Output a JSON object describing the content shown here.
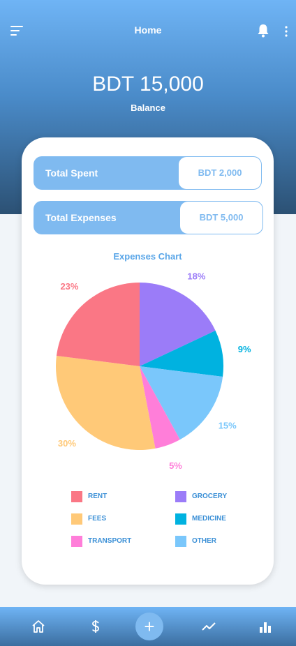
{
  "header": {
    "title": "Home",
    "balance_amount": "BDT 15,000",
    "balance_label": "Balance"
  },
  "icons": {
    "menu": "menu-icon",
    "notifications": "bell-icon",
    "more": "more-vertical-icon"
  },
  "stats": [
    {
      "label": "Total Spent",
      "value": "BDT 2,000"
    },
    {
      "label": "Total Expenses",
      "value": "BDT 5,000"
    }
  ],
  "chart": {
    "title": "Expenses Chart"
  },
  "chart_data": {
    "type": "pie",
    "title": "Expenses Chart",
    "slices": [
      {
        "name": "GROCERY",
        "value": 18,
        "label": "18%",
        "color": "#9b7cf8"
      },
      {
        "name": "MEDICINE",
        "value": 9,
        "label": "9%",
        "color": "#00b2e0"
      },
      {
        "name": "OTHER",
        "value": 15,
        "label": "15%",
        "color": "#7ac7fb"
      },
      {
        "name": "TRANSPORT",
        "value": 5,
        "label": "5%",
        "color": "#ff7ed9"
      },
      {
        "name": "FEES",
        "value": 30,
        "label": "30%",
        "color": "#ffc978"
      },
      {
        "name": "RENT",
        "value": 23,
        "label": "23%",
        "color": "#fa7785"
      }
    ],
    "legend_placement": "bottom"
  },
  "legend": [
    {
      "label": "RENT",
      "color": "#fa7785"
    },
    {
      "label": "GROCERY",
      "color": "#9b7cf8"
    },
    {
      "label": "FEES",
      "color": "#ffc978"
    },
    {
      "label": "MEDICINE",
      "color": "#00b2e0"
    },
    {
      "label": "TRANSPORT",
      "color": "#ff7ed9"
    },
    {
      "label": "OTHER",
      "color": "#7ac7fb"
    }
  ],
  "nav": {
    "items": [
      "home-icon",
      "dollar-icon",
      "add-icon",
      "trend-icon",
      "bar-chart-icon"
    ],
    "add_symbol": "+"
  },
  "colors": {
    "accent": "#7fbaf0",
    "header_top": "#6fb4f5",
    "header_bottom": "#2c5174"
  }
}
